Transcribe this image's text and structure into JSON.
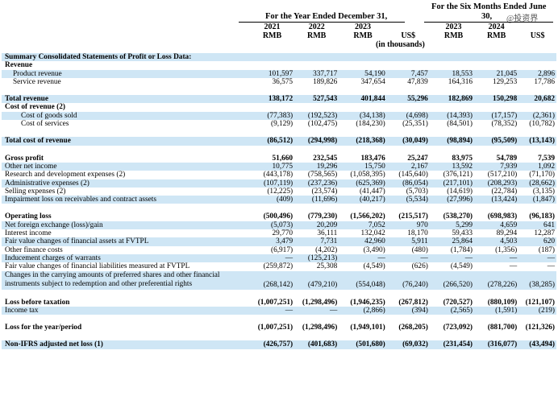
{
  "header": {
    "six_months_title_1": "For the Six Months Ended June",
    "six_months_title_2": "30,",
    "year_title": "For the Year Ended December 31,",
    "years": [
      "2021",
      "2022",
      "2023",
      "",
      "2023",
      "2024",
      ""
    ],
    "currencies": [
      "RMB",
      "RMB",
      "RMB",
      "US$",
      "RMB",
      "RMB",
      "US$"
    ],
    "units": "(in thousands)",
    "watermark": "@投资界"
  },
  "rows": [
    {
      "label": "Summary Consolidated Statements of Profit or Loss Data:",
      "indent": 1,
      "bold": true,
      "shade": true,
      "values": [
        "",
        "",
        "",
        "",
        "",
        "",
        ""
      ]
    },
    {
      "label": "Revenue",
      "indent": 1,
      "bold": true,
      "shade": false,
      "values": [
        "",
        "",
        "",
        "",
        "",
        "",
        ""
      ]
    },
    {
      "label": "Product revenue",
      "indent": 2,
      "bold": false,
      "shade": true,
      "values": [
        "101,597",
        "337,717",
        "54,190",
        "7,457",
        "18,553",
        "21,045",
        "2,896"
      ]
    },
    {
      "label": "Service revenue",
      "indent": 2,
      "bold": false,
      "shade": false,
      "values": [
        "36,575",
        "189,826",
        "347,654",
        "47,839",
        "164,316",
        "129,253",
        "17,786"
      ]
    },
    {
      "gap": "lg"
    },
    {
      "label": "Total revenue",
      "indent": 1,
      "bold": true,
      "shade": true,
      "values": [
        "138,172",
        "527,543",
        "401,844",
        "55,296",
        "182,869",
        "150,298",
        "20,682"
      ]
    },
    {
      "label": "Cost of revenue (2)",
      "indent": 1,
      "bold": true,
      "shade": false,
      "values": [
        "",
        "",
        "",
        "",
        "",
        "",
        ""
      ]
    },
    {
      "label": "Cost of goods sold",
      "indent": 3,
      "bold": false,
      "shade": true,
      "values": [
        "(77,383)",
        "(192,523)",
        "(34,138)",
        "(4,698)",
        "(14,393)",
        "(17,157)",
        "(2,361)"
      ]
    },
    {
      "label": "Cost of services",
      "indent": 3,
      "bold": false,
      "shade": false,
      "values": [
        "(9,129)",
        "(102,475)",
        "(184,230)",
        "(25,351)",
        "(84,501)",
        "(78,352)",
        "(10,782)"
      ]
    },
    {
      "gap": "lg"
    },
    {
      "label": "Total cost of revenue",
      "indent": 1,
      "bold": true,
      "shade": true,
      "values": [
        "(86,512)",
        "(294,998)",
        "(218,368)",
        "(30,049)",
        "(98,894)",
        "(95,509)",
        "(13,143)"
      ]
    },
    {
      "gap": "lg"
    },
    {
      "label": "Gross profit",
      "indent": 1,
      "bold": true,
      "shade": false,
      "values": [
        "51,660",
        "232,545",
        "183,476",
        "25,247",
        "83,975",
        "54,789",
        "7,539"
      ]
    },
    {
      "label": "Other net income",
      "indent": 1,
      "bold": false,
      "shade": true,
      "values": [
        "10,775",
        "19,296",
        "15,750",
        "2,167",
        "13,592",
        "7,939",
        "1,092"
      ]
    },
    {
      "label": "Research and development expenses (2)",
      "indent": 1,
      "bold": false,
      "shade": false,
      "values": [
        "(443,178)",
        "(758,565)",
        "(1,058,395)",
        "(145,640)",
        "(376,121)",
        "(517,210)",
        "(71,170)"
      ]
    },
    {
      "label": "Administrative expenses (2)",
      "indent": 1,
      "bold": false,
      "shade": true,
      "values": [
        "(107,119)",
        "(237,236)",
        "(625,369)",
        "(86,054)",
        "(217,101)",
        "(208,293)",
        "(28,662)"
      ]
    },
    {
      "label": "Selling expenses (2)",
      "indent": 1,
      "bold": false,
      "shade": false,
      "values": [
        "(12,225)",
        "(23,574)",
        "(41,447)",
        "(5,703)",
        "(14,619)",
        "(22,784)",
        "(3,135)"
      ]
    },
    {
      "label": "Impairment loss on receivables and contract assets",
      "indent": 1,
      "bold": false,
      "shade": true,
      "values": [
        "(409)",
        "(11,696)",
        "(40,217)",
        "(5,534)",
        "(27,996)",
        "(13,424)",
        "(1,847)"
      ]
    },
    {
      "gap": "lg"
    },
    {
      "label": "Operating loss",
      "indent": 1,
      "bold": true,
      "shade": false,
      "values": [
        "(500,496)",
        "(779,230)",
        "(1,566,202)",
        "(215,517)",
        "(538,270)",
        "(698,983)",
        "(96,183)"
      ]
    },
    {
      "label": "Net foreign exchange (loss)/gain",
      "indent": 1,
      "bold": false,
      "shade": true,
      "values": [
        "(5,073)",
        "20,209",
        "7,052",
        "970",
        "5,299",
        "4,659",
        "641"
      ]
    },
    {
      "label": "Interest income",
      "indent": 1,
      "bold": false,
      "shade": false,
      "values": [
        "29,770",
        "36,111",
        "132,042",
        "18,170",
        "59,433",
        "89,294",
        "12,287"
      ]
    },
    {
      "label": "Fair value changes of financial assets at FVTPL",
      "indent": 1,
      "bold": false,
      "shade": true,
      "values": [
        "3,479",
        "7,731",
        "42,960",
        "5,911",
        "25,864",
        "4,503",
        "620"
      ]
    },
    {
      "label": "Other finance costs",
      "indent": 1,
      "bold": false,
      "shade": false,
      "values": [
        "(6,917)",
        "(4,202)",
        "(3,490)",
        "(480)",
        "(1,784)",
        "(1,356)",
        "(187)"
      ]
    },
    {
      "label": "Inducement charges of warrants",
      "indent": 1,
      "bold": false,
      "shade": true,
      "values": [
        "—",
        "(125,213)",
        "—",
        "—",
        "—",
        "—",
        "—"
      ]
    },
    {
      "label": "Fair value changes of financial liabilities measured at FVTPL",
      "indent": 1,
      "bold": false,
      "shade": false,
      "values": [
        "(259,872)",
        "25,308",
        "(4,549)",
        "(626)",
        "(4,549)",
        "—",
        "—"
      ]
    },
    {
      "label": "Changes in the carrying amounts of preferred shares and other financial instruments subject to redemption and other preferential rights",
      "indent": 1,
      "bold": false,
      "shade": true,
      "multiline": true,
      "values": [
        "(268,142)",
        "(479,210)",
        "(554,048)",
        "(76,240)",
        "(266,520)",
        "(278,226)",
        "(38,285)"
      ]
    },
    {
      "gap": "lg"
    },
    {
      "label": "Loss before taxation",
      "indent": 1,
      "bold": true,
      "shade": false,
      "values": [
        "(1,007,251)",
        "(1,298,496)",
        "(1,946,235)",
        "(267,812)",
        "(720,527)",
        "(880,109)",
        "(121,107)"
      ]
    },
    {
      "label": "Income tax",
      "indent": 1,
      "bold": false,
      "shade": true,
      "values": [
        "—",
        "—",
        "(2,866)",
        "(394)",
        "(2,565)",
        "(1,591)",
        "(219)"
      ]
    },
    {
      "gap": "lg"
    },
    {
      "label": "Loss for the year/period",
      "indent": 1,
      "bold": true,
      "shade": false,
      "values": [
        "(1,007,251)",
        "(1,298,496)",
        "(1,949,101)",
        "(268,205)",
        "(723,092)",
        "(881,700)",
        "(121,326)"
      ]
    },
    {
      "gap": "lg"
    },
    {
      "label": "Non-IFRS adjusted net loss (1)",
      "indent": 1,
      "bold": true,
      "shade": true,
      "values": [
        "(426,757)",
        "(401,683)",
        "(501,680)",
        "(69,032)",
        "(231,454)",
        "(316,077)",
        "(43,494)"
      ]
    }
  ]
}
